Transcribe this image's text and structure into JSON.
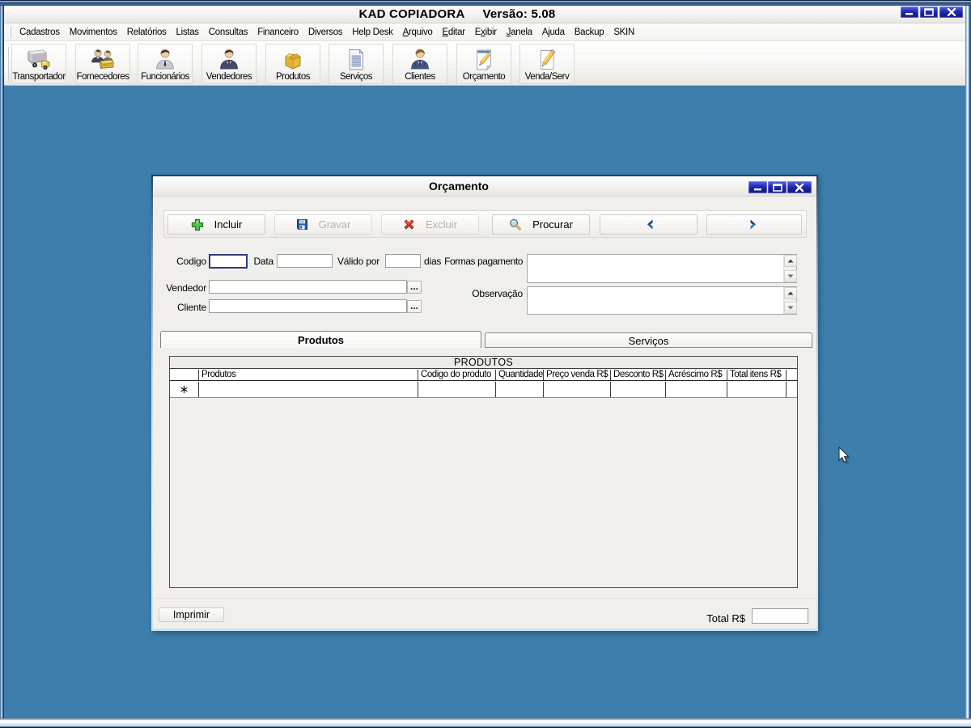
{
  "window": {
    "title": "KAD COPIADORA",
    "version": "Versão: 5.08"
  },
  "menu_bar": {
    "items": [
      {
        "label": "Cadastros"
      },
      {
        "label": "Movimentos"
      },
      {
        "label": "Relatórios"
      },
      {
        "label": "Listas"
      },
      {
        "label": "Consultas"
      },
      {
        "label": "Financeiro"
      },
      {
        "label": "Diversos"
      },
      {
        "label": "Help Desk"
      },
      {
        "label": "Arquivo",
        "underline_index": 0
      },
      {
        "label": "Editar",
        "underline_index": 0
      },
      {
        "label": "Exibir",
        "underline_index": 1
      },
      {
        "label": "Janela",
        "underline_index": 0
      },
      {
        "label": "Ajuda"
      },
      {
        "label": "Backup"
      },
      {
        "label": "SKIN"
      }
    ]
  },
  "toolbar": {
    "buttons": [
      {
        "label": "Transportador",
        "icon": "truck-icon"
      },
      {
        "label": "Fornecedores",
        "icon": "suppliers-icon"
      },
      {
        "label": "Funcionários",
        "icon": "employee-icon"
      },
      {
        "label": "Vendedores",
        "icon": "salesman-icon"
      },
      {
        "label": "Produtos",
        "icon": "box-icon"
      },
      {
        "label": "Serviços",
        "icon": "document-icon"
      },
      {
        "label": "Clientes",
        "icon": "client-icon"
      },
      {
        "label": "Orçamento",
        "icon": "quote-icon"
      },
      {
        "label": "Venda/Serv",
        "icon": "pencil-icon"
      }
    ]
  },
  "dialog": {
    "title": "Orçamento",
    "actions": {
      "incluir": {
        "label": "Incluir",
        "enabled": true,
        "icon": "plus-icon"
      },
      "gravar": {
        "label": "Gravar",
        "enabled": false,
        "icon": "save-icon"
      },
      "excluir": {
        "label": "Excluir",
        "enabled": false,
        "icon": "delete-icon"
      },
      "procurar": {
        "label": "Procurar",
        "enabled": true,
        "icon": "search-icon"
      },
      "anterior": {
        "icon": "arrow-left-icon"
      },
      "proximo": {
        "icon": "arrow-right-icon"
      }
    },
    "form": {
      "codigo": {
        "label": "Codigo",
        "value": ""
      },
      "data": {
        "label": "Data",
        "value": ""
      },
      "valido_por": {
        "label": "Válido por",
        "value": "",
        "suffix": "dias"
      },
      "formas_pagamento": {
        "label": "Formas pagamento",
        "value": ""
      },
      "vendedor": {
        "label": "Vendedor",
        "value": ""
      },
      "cliente": {
        "label": "Cliente",
        "value": ""
      },
      "observacao": {
        "label": "Observação",
        "value": ""
      },
      "lookup_label": "..."
    },
    "tabs": [
      {
        "label": "Produtos",
        "active": true
      },
      {
        "label": "Serviços",
        "active": false
      }
    ],
    "grid": {
      "group_header": "PRODUTOS",
      "columns": [
        "Produtos",
        "Codigo do produto",
        "Quantidade",
        "Preço venda R$",
        "Desconto R$",
        "Acréscimo R$",
        "Total itens R$"
      ],
      "new_record_marker": "*"
    },
    "footer": {
      "imprimir_label": "Imprimir",
      "total_label": "Total R$",
      "total_value": ""
    }
  },
  "colors": {
    "desktop": "#3e7eac",
    "window_button_blue": "#1d2b9e",
    "frame_navy": "#1b3a5e"
  }
}
